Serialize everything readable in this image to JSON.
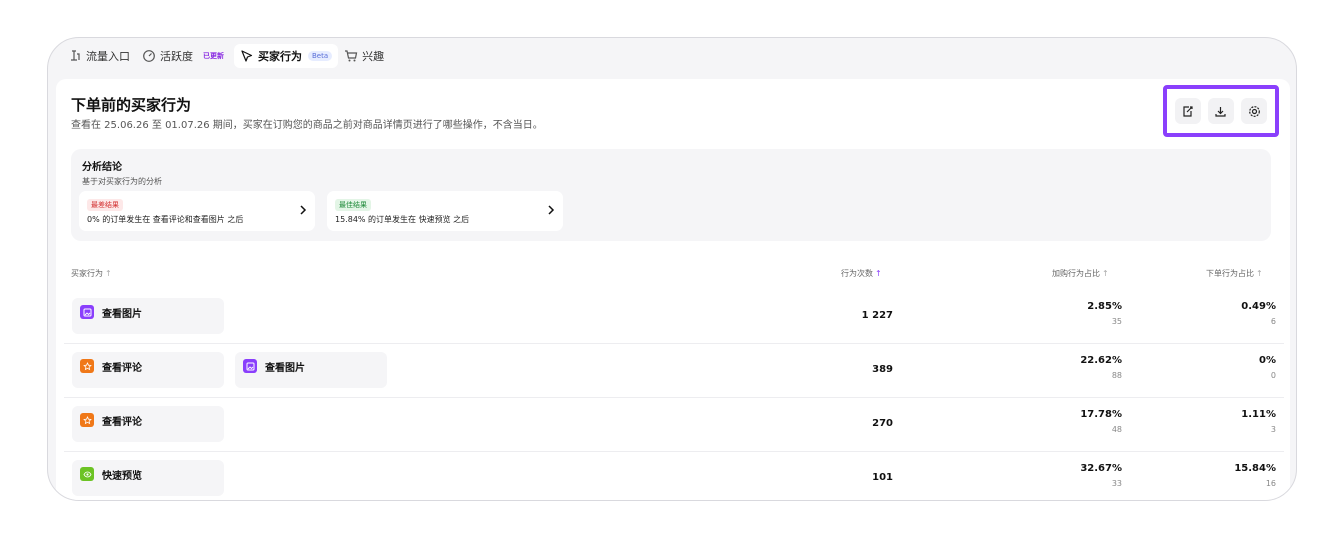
{
  "tabs": [
    {
      "label": "流量入口",
      "icon": "traffic-entry-icon",
      "badge": ""
    },
    {
      "label": "活跃度",
      "icon": "activity-gauge-icon",
      "badge": "已更新"
    },
    {
      "label": "买家行为",
      "icon": "cursor-icon",
      "badge": "Beta"
    },
    {
      "label": "兴趣",
      "icon": "cart-icon",
      "badge": ""
    }
  ],
  "header": {
    "title": "下单前的买家行为",
    "subtitle": "查看在 25.06.26 至 01.07.26 期间，买家在订购您的商品之前对商品详情页进行了哪些操作，不含当日。"
  },
  "actions": [
    {
      "icon": "edit-export-icon"
    },
    {
      "icon": "download-icon"
    },
    {
      "icon": "settings-icon"
    }
  ],
  "analysis": {
    "title": "分析结论",
    "subtitle": "基于对买家行为的分析",
    "cards": [
      {
        "tag": "最差结果",
        "text": "0% 的订单发生在 查看评论和查看图片 之后"
      },
      {
        "tag": "最佳结果",
        "text": "15.84% 的订单发生在 快速预览 之后"
      }
    ]
  },
  "table": {
    "headers": {
      "behavior": "买家行为",
      "count": "行为次数",
      "cart_ratio": "加购行为占比",
      "order_ratio": "下单行为占比"
    },
    "rows": [
      {
        "chips": [
          {
            "label": "查看图片",
            "icon": "image-icon",
            "color": "#8a3ffc"
          }
        ],
        "count": "1 227",
        "cart_pct": "2.85%",
        "cart_n": "35",
        "order_pct": "0.49%",
        "order_n": "6"
      },
      {
        "chips": [
          {
            "label": "查看评论",
            "icon": "star-icon",
            "color": "#f07818"
          },
          {
            "label": "查看图片",
            "icon": "image-icon",
            "color": "#8a3ffc"
          }
        ],
        "count": "389",
        "cart_pct": "22.62%",
        "cart_n": "88",
        "order_pct": "0%",
        "order_n": "0"
      },
      {
        "chips": [
          {
            "label": "查看评论",
            "icon": "star-icon",
            "color": "#f07818"
          }
        ],
        "count": "270",
        "cart_pct": "17.78%",
        "cart_n": "48",
        "order_pct": "1.11%",
        "order_n": "3"
      },
      {
        "chips": [
          {
            "label": "快速预览",
            "icon": "eye-icon",
            "color": "#6cc324"
          }
        ],
        "count": "101",
        "cart_pct": "32.67%",
        "cart_n": "33",
        "order_pct": "15.84%",
        "order_n": "16"
      }
    ]
  },
  "colors": {
    "accent": "#8a3ffc",
    "worst": "#d23030",
    "best": "#1f8a3a"
  }
}
